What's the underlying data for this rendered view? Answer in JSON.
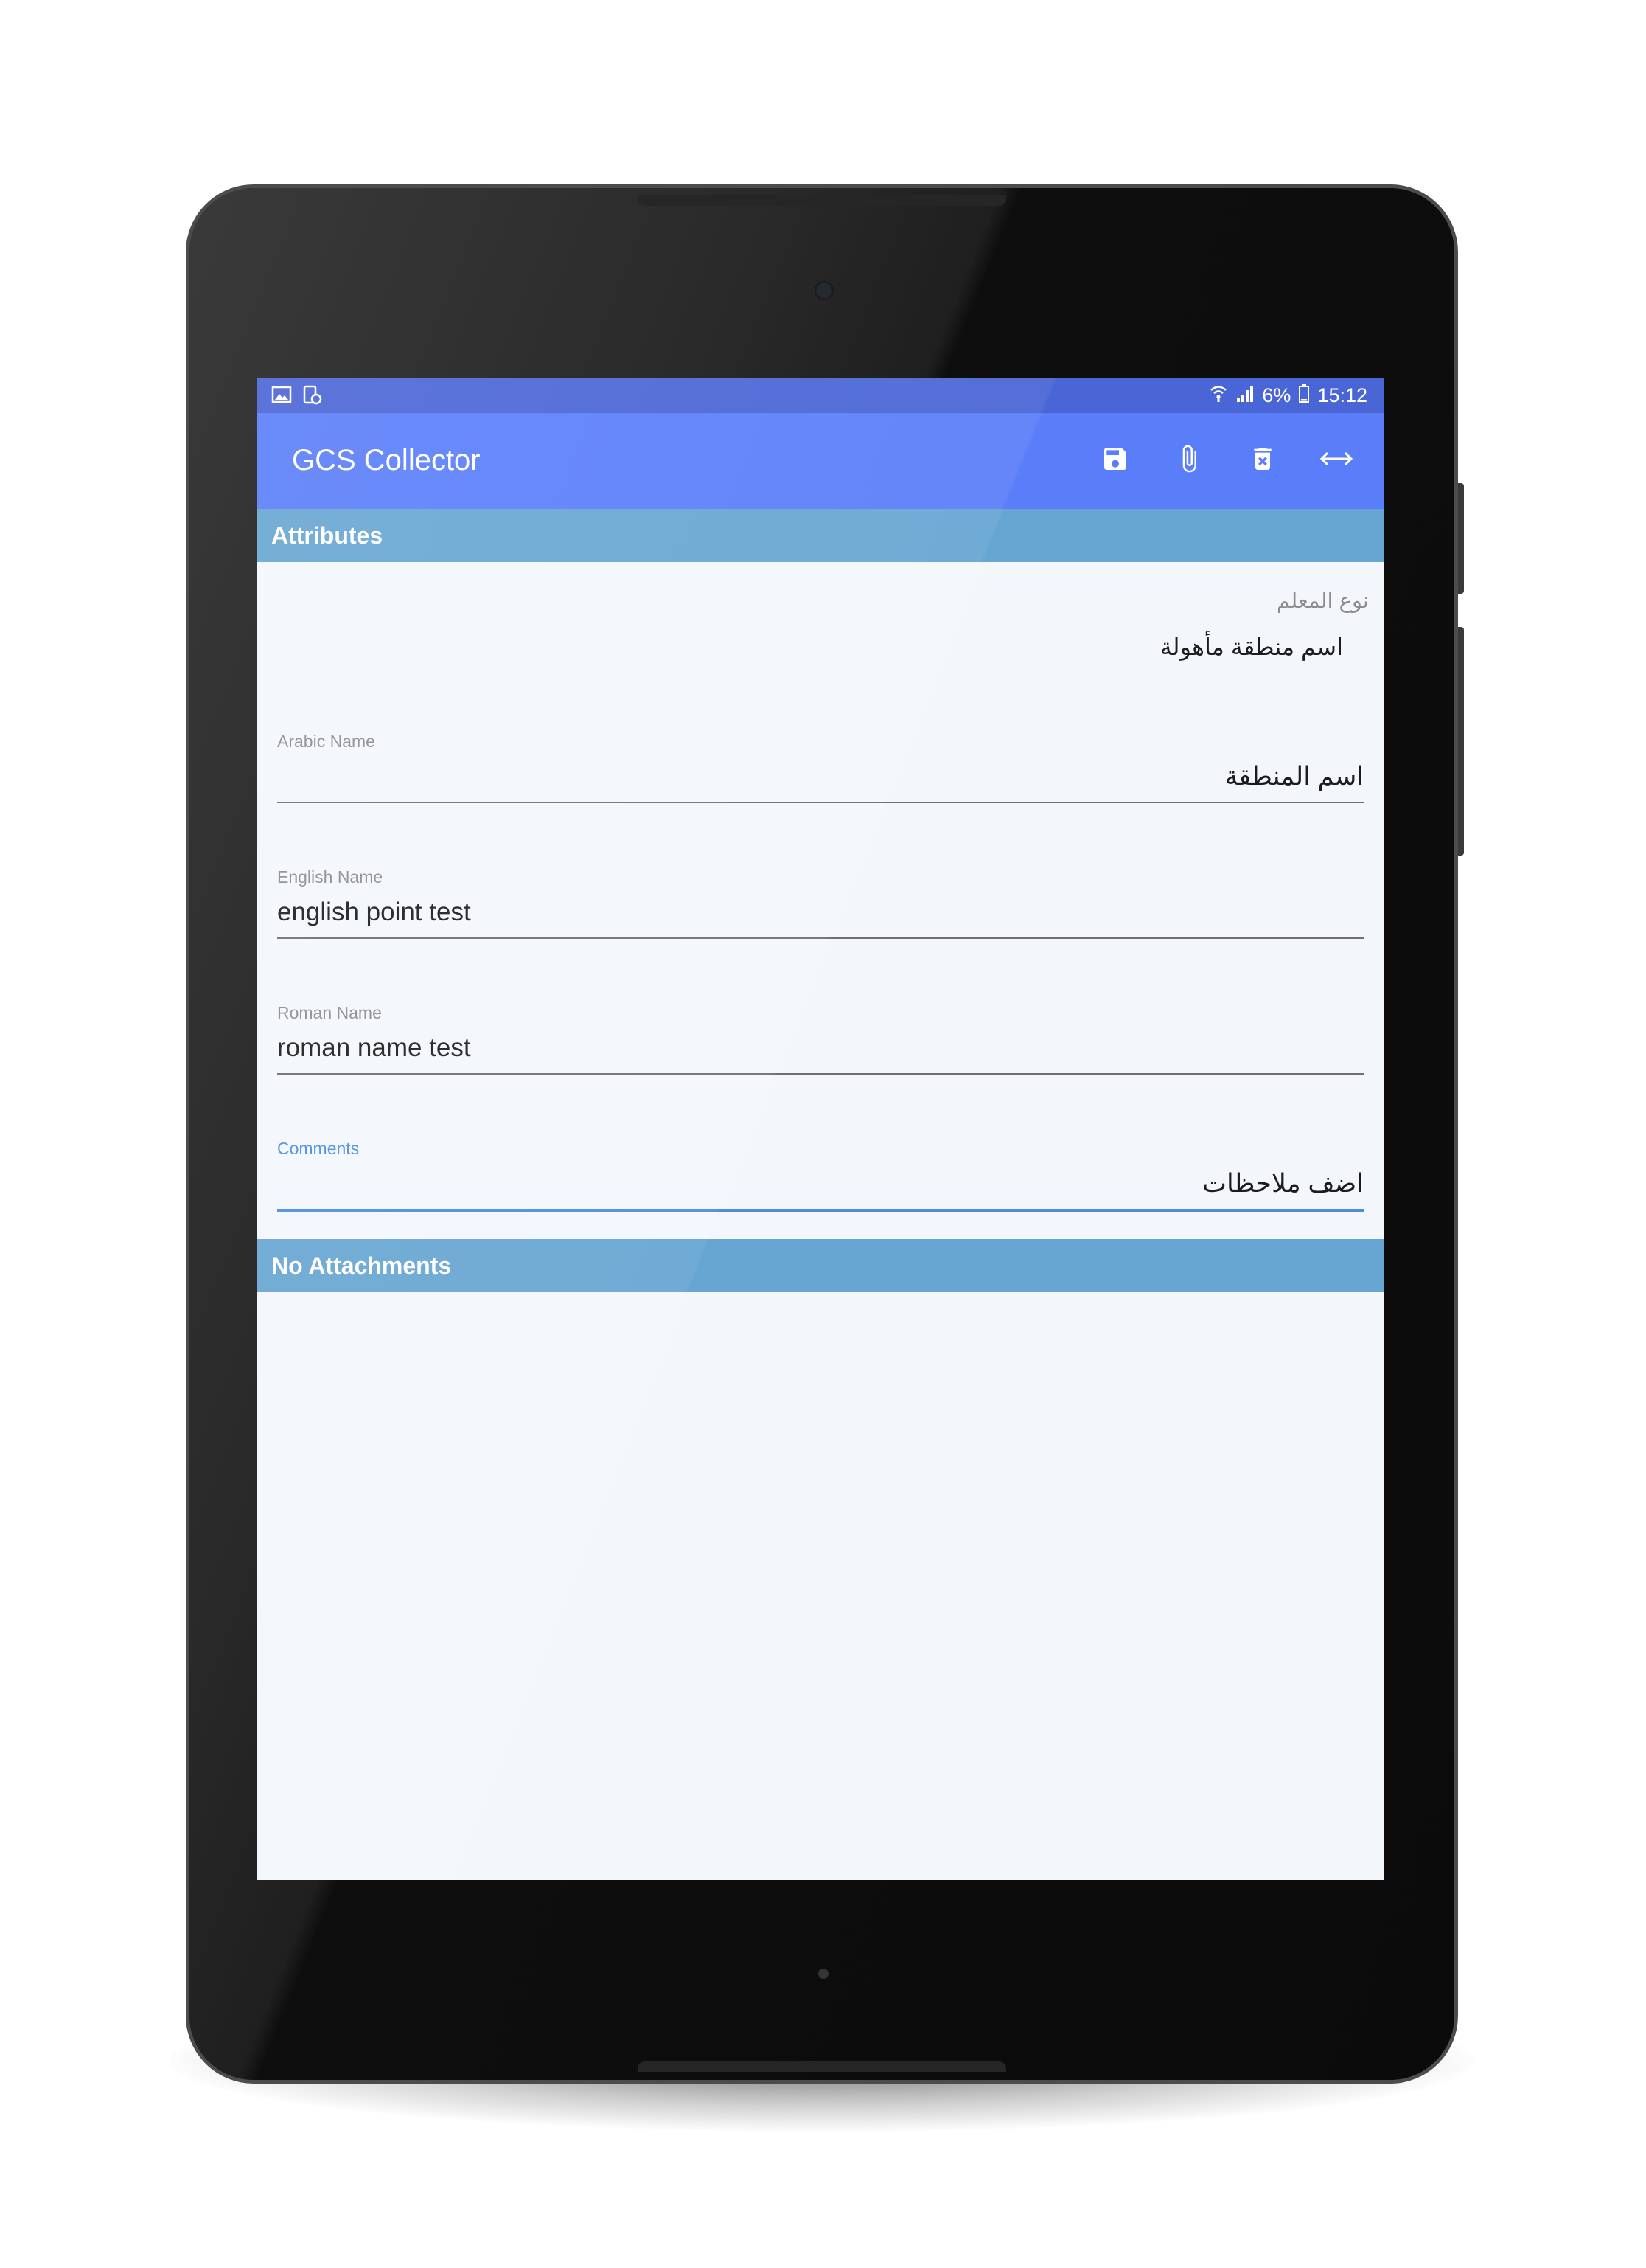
{
  "status_bar": {
    "left_icons": [
      "image-icon",
      "device-info-icon"
    ],
    "battery": "6%",
    "time": "15:12"
  },
  "app_bar": {
    "title": "GCS Collector",
    "actions": [
      "save-icon",
      "attach-icon",
      "delete-icon",
      "swap-horizontal-icon"
    ]
  },
  "attributes_header": "Attributes",
  "feature_type": {
    "label": "نوع المعلم",
    "value": "اسم منطقة مأهولة"
  },
  "fields": {
    "arabic_name": {
      "label": "Arabic Name",
      "value": "اسم المنطقة"
    },
    "english_name": {
      "label": "English Name",
      "value": "english point test"
    },
    "roman_name": {
      "label": "Roman Name",
      "value": "roman name test"
    },
    "comments": {
      "label": "Comments",
      "value": "اضف ملاحظات"
    }
  },
  "attachments_header": "No Attachments",
  "colors": {
    "status_bar": "#4a65d6",
    "app_bar": "#5a7ef9",
    "section_header": "#67a6d2",
    "screen_bg": "#f3f7fc",
    "focus": "#4b8edb"
  }
}
